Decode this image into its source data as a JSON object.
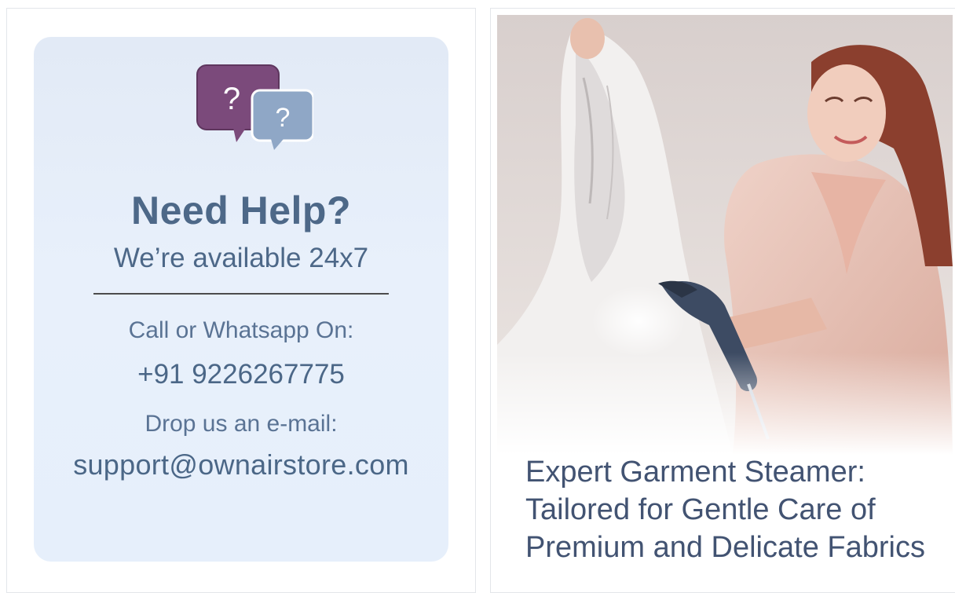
{
  "help": {
    "title": "Need Help?",
    "subtitle": "We’re available 24x7",
    "call_label": "Call or Whatsapp On:",
    "phone": "+91 9226267775",
    "mail_label": "Drop us an e-mail:",
    "email": "support@ownairstore.com",
    "bubble_glyph_1": "?",
    "bubble_glyph_2": "?",
    "icon": "question-chat-bubbles-icon",
    "colors": {
      "card_bg": "#e6eef9",
      "text": "#4d6888",
      "bubble_primary": "#7b4a7b",
      "bubble_secondary": "#8fa7c6"
    }
  },
  "promo": {
    "image_alt": "garment-steamer-photo",
    "caption_line_1": "Expert Garment Steamer:",
    "caption_line_2": "Tailored for Gentle Care of",
    "caption_line_3": "Premium and Delicate Fabrics",
    "colors": {
      "caption": "#425372",
      "robe": "#e8c3b8"
    }
  }
}
